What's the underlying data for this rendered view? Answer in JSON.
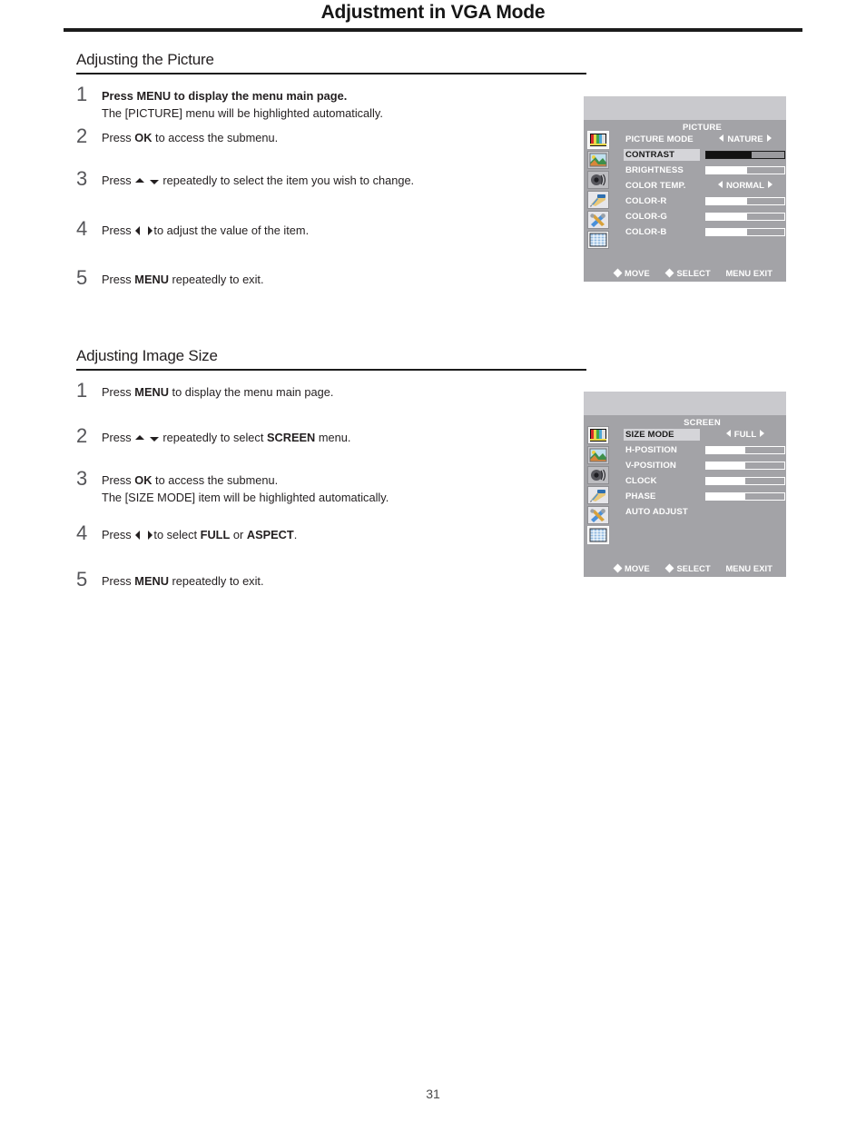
{
  "page": {
    "title": "Adjustment in VGA Mode",
    "number": "31"
  },
  "sections": [
    {
      "heading": "Adjusting the Picture",
      "steps": [
        {
          "num": "1",
          "pre": "Press ",
          "bold": "MENU",
          "post": " to display the menu main page.",
          "line2": "The [PICTURE] menu will be highlighted automatically."
        },
        {
          "num": "2",
          "pre": "Press ",
          "bold": "OK",
          "post": " to access the submenu.",
          "line2": ""
        },
        {
          "num": "3",
          "pre": "Press ",
          "bold": "",
          "post": " repeatedly to select the item you wish to change.",
          "line2": ""
        },
        {
          "num": "4",
          "pre": "Press ",
          "bold": "",
          "post": "to adjust the value of the item.",
          "line2": ""
        },
        {
          "num": "5",
          "pre": "Press ",
          "bold": "MENU",
          "post": " repeatedly to exit.",
          "line2": ""
        }
      ]
    },
    {
      "heading": "Adjusting Image Size",
      "steps": [
        {
          "num": "1",
          "pre": "Press ",
          "bold": "MENU",
          "post": " to display the menu main page.",
          "line2": ""
        },
        {
          "num": "2",
          "pre": "Press ",
          "bold": "SCREEN",
          "post": " menu.",
          "mid": " repeatedly to select ",
          "line2": ""
        },
        {
          "num": "3",
          "pre": "Press ",
          "bold": "OK",
          "post": " to access the submenu.",
          "line2": "The [SIZE MODE] item will be highlighted automatically."
        },
        {
          "num": "4",
          "pre": "Press ",
          "bold": "FULL",
          "post": ".",
          "mid": "to select ",
          "or": " or ",
          "bold2": "ASPECT",
          "line2": ""
        },
        {
          "num": "5",
          "pre": "Press ",
          "bold": "MENU",
          "post": " repeatedly to exit.",
          "line2": ""
        }
      ]
    }
  ],
  "osd_picture": {
    "heading": "PICTURE",
    "selected_icon": 0,
    "rows": [
      {
        "label": "PICTURE MODE",
        "type": "option",
        "value": "NATURE",
        "highlight": false
      },
      {
        "label": "CONTRAST",
        "type": "bar",
        "fill": 58,
        "dark": true,
        "highlight": true
      },
      {
        "label": "BRIGHTNESS",
        "type": "bar",
        "fill": 52,
        "dark": false,
        "highlight": false
      },
      {
        "label": "COLOR TEMP.",
        "type": "option",
        "value": "NORMAL",
        "highlight": false
      },
      {
        "label": "COLOR-R",
        "type": "bar",
        "fill": 52,
        "dark": false,
        "highlight": false
      },
      {
        "label": "COLOR-G",
        "type": "bar",
        "fill": 52,
        "dark": false,
        "highlight": false
      },
      {
        "label": "COLOR-B",
        "type": "bar",
        "fill": 52,
        "dark": false,
        "highlight": false
      }
    ],
    "footer": {
      "move": "MOVE",
      "select": "SELECT",
      "menu": "MENU",
      "exit": "EXIT"
    }
  },
  "osd_screen": {
    "heading": "SCREEN",
    "selected_icon": 5,
    "rows": [
      {
        "label": "SIZE MODE",
        "type": "option",
        "value": "FULL",
        "highlight": true
      },
      {
        "label": "H-POSITION",
        "type": "bar",
        "fill": 50,
        "dark": false,
        "highlight": false
      },
      {
        "label": "V-POSITION",
        "type": "bar",
        "fill": 50,
        "dark": false,
        "highlight": false
      },
      {
        "label": "CLOCK",
        "type": "bar",
        "fill": 50,
        "dark": false,
        "highlight": false
      },
      {
        "label": "PHASE",
        "type": "bar",
        "fill": 50,
        "dark": false,
        "highlight": false
      },
      {
        "label": "AUTO ADJUST",
        "type": "none",
        "value": "",
        "highlight": false
      }
    ],
    "footer": {
      "move": "MOVE",
      "select": "SELECT",
      "menu": "MENU",
      "exit": "EXIT"
    }
  },
  "osd_icons": [
    "color-bars-picture-icon",
    "landscape-image-icon",
    "speaker-sound-icon",
    "paint-roller-setup-icon",
    "tools-function-icon",
    "grid-screen-icon"
  ]
}
